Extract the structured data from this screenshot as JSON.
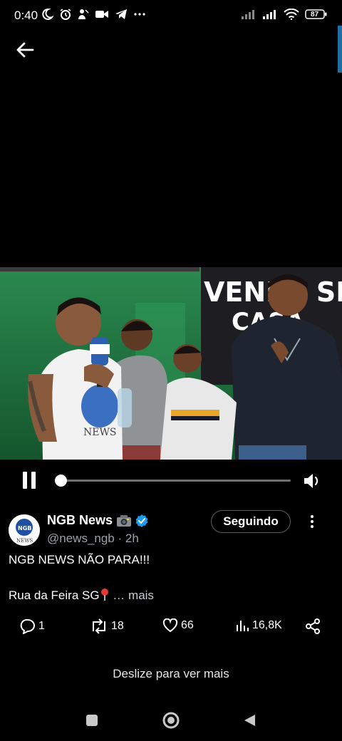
{
  "status_bar": {
    "time": "0:40",
    "battery": "87"
  },
  "post": {
    "author_name": "NGB News",
    "author_handle": "@news_ngb",
    "time_ago": "· 2h",
    "follow_label": "Seguindo",
    "text_line1": "NGB NEWS NÃO PARA!!!",
    "text_line2": "Rua da Feira SG",
    "more_label": "mais",
    "avatar_text": "NGB",
    "avatar_sub": "NEWS"
  },
  "video": {
    "banner_text_1": "VENDE SE",
    "banner_text_2": "CASA",
    "mic_label": "NEWS",
    "progress": 0.02
  },
  "stats": {
    "replies": "1",
    "reposts": "18",
    "likes": "66",
    "views": "16,8K"
  },
  "footer": {
    "swipe_hint": "Deslize para ver mais"
  },
  "icons": [
    "moon-icon",
    "alarm-icon",
    "dnd-icon",
    "video-icon",
    "telegram-icon",
    "more-dots-icon",
    "signal-icon",
    "wifi-icon",
    "battery-icon",
    "back-arrow-icon",
    "pause-icon",
    "volume-icon",
    "camera-emoji-icon",
    "verified-badge-icon",
    "kebab-icon",
    "reply-icon",
    "repost-icon",
    "like-icon",
    "views-icon",
    "share-icon",
    "pin-icon",
    "home-icon",
    "square-icon",
    "triangle-back-icon"
  ]
}
